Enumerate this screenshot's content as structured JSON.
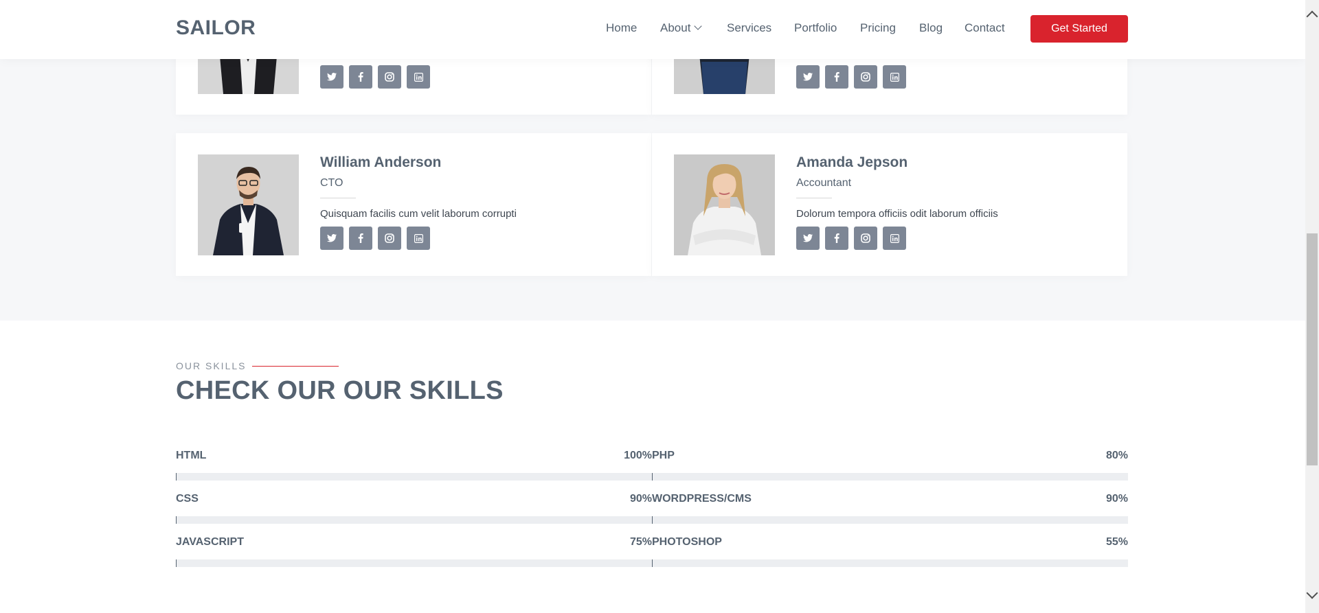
{
  "header": {
    "logo": "SAILOR",
    "nav": [
      {
        "label": "Home",
        "name": "nav-home"
      },
      {
        "label": "About",
        "name": "nav-about",
        "dropdown": true
      },
      {
        "label": "Services",
        "name": "nav-services"
      },
      {
        "label": "Portfolio",
        "name": "nav-portfolio"
      },
      {
        "label": "Pricing",
        "name": "nav-pricing"
      },
      {
        "label": "Blog",
        "name": "nav-blog"
      },
      {
        "label": "Contact",
        "name": "nav-contact"
      }
    ],
    "cta": "Get Started"
  },
  "team": {
    "members": [
      {
        "name": "William Anderson",
        "role": "CTO",
        "bio": "Quisquam facilis cum velit laborum corrupti",
        "socials": [
          "twitter-icon",
          "facebook-icon",
          "instagram-icon",
          "linkedin-icon"
        ]
      },
      {
        "name": "Amanda Jepson",
        "role": "Accountant",
        "bio": "Dolorum tempora officiis odit laborum officiis",
        "socials": [
          "twitter-icon",
          "facebook-icon",
          "instagram-icon",
          "linkedin-icon"
        ]
      }
    ]
  },
  "skills": {
    "label": "OUR SKILLS",
    "title": "CHECK OUR OUR SKILLS",
    "items": [
      {
        "name": "HTML",
        "value": "100%",
        "level": 1.0
      },
      {
        "name": "PHP",
        "value": "80%",
        "level": 0.8
      },
      {
        "name": "CSS",
        "value": "90%",
        "level": 0.9
      },
      {
        "name": "WORDPRESS/CMS",
        "value": "90%",
        "level": 0.9
      },
      {
        "name": "JAVASCRIPT",
        "value": "75%",
        "level": 0.75
      },
      {
        "name": "PHOTOSHOP",
        "value": "55%",
        "level": 0.55
      }
    ]
  },
  "colors": {
    "accent": "#d9232d",
    "text": "#556270",
    "social_bg": "#7d8695",
    "section_bg": "#f6f7f9"
  }
}
